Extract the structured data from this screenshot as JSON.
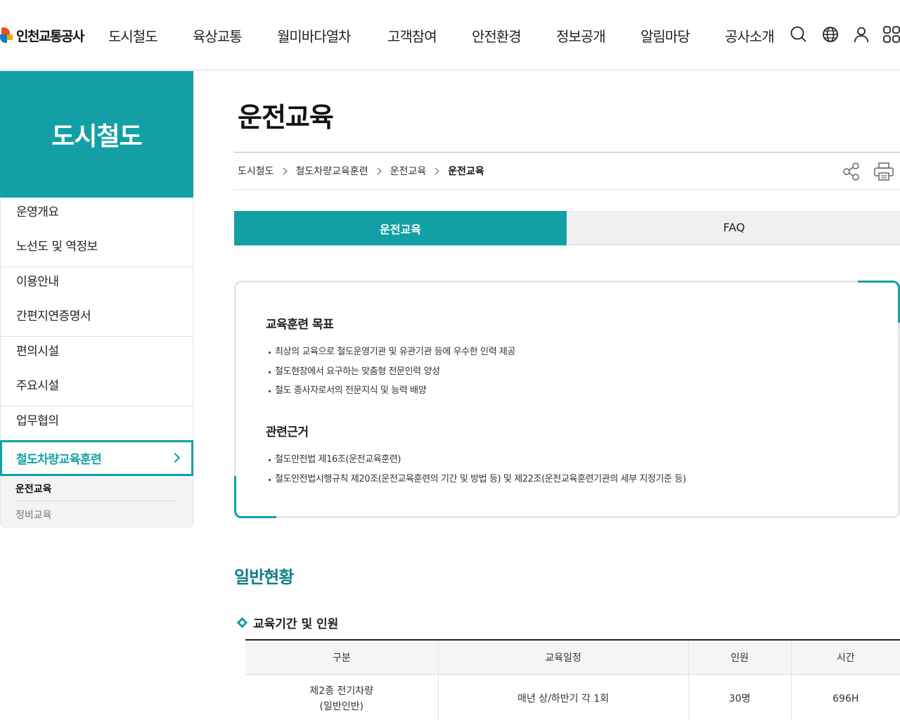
{
  "header": {
    "logo_text": "인천교통공사",
    "menu": [
      "도시철도",
      "육상교통",
      "월미바다열차",
      "고객참여",
      "안전환경",
      "정보공개",
      "알림마당",
      "공사소개"
    ],
    "util_icons": [
      "search-icon",
      "globe-icon",
      "user-icon",
      "sitemap-icon"
    ]
  },
  "lnb": {
    "title": "도시철도",
    "items": [
      "운영개요",
      "노선도 및 역정보",
      "이용안내",
      "간편지연증명서",
      "편의시설",
      "주요시설",
      "업무협의"
    ],
    "active": "철도차량교육훈련",
    "sub": [
      "운전교육",
      "정비교육"
    ]
  },
  "content": {
    "title": "운전교육",
    "breadcrumb": [
      "도시철도",
      "철도차량교육훈련",
      "운전교육",
      "운전교육"
    ],
    "tabs": [
      "운전교육",
      "FAQ"
    ],
    "goal_title": "교육훈련 목표",
    "goals": [
      "최상의 교육으로 철도운영기관 및 유관기관 등에 우수한 인력 제공",
      "철도현장에서 요구하는 맞춤형 전문인력 양성",
      "철도 종사자로서의 전문지식 및 능력 배양"
    ],
    "basis_title": "관련근거",
    "basis": [
      "철도안전법 제16조(운전교육훈련)",
      "철도안전법시행규칙 제20조(운전교육훈련의 기간 및 방법 등)  및 제22조(운전교육훈련기관의 세부 지정기준 등)"
    ],
    "section_title": "일반현황",
    "sub_title": "교육기간 및 인원",
    "table": {
      "headers": [
        "구분",
        "교육일정",
        "인원",
        "시간"
      ],
      "rows": [
        {
          "category_1": "제2종 전기차량",
          "category_2": "(일반인반)",
          "schedule": "매년 상/하반기 각 1회",
          "people": "30명",
          "hours": "696H"
        }
      ]
    }
  }
}
